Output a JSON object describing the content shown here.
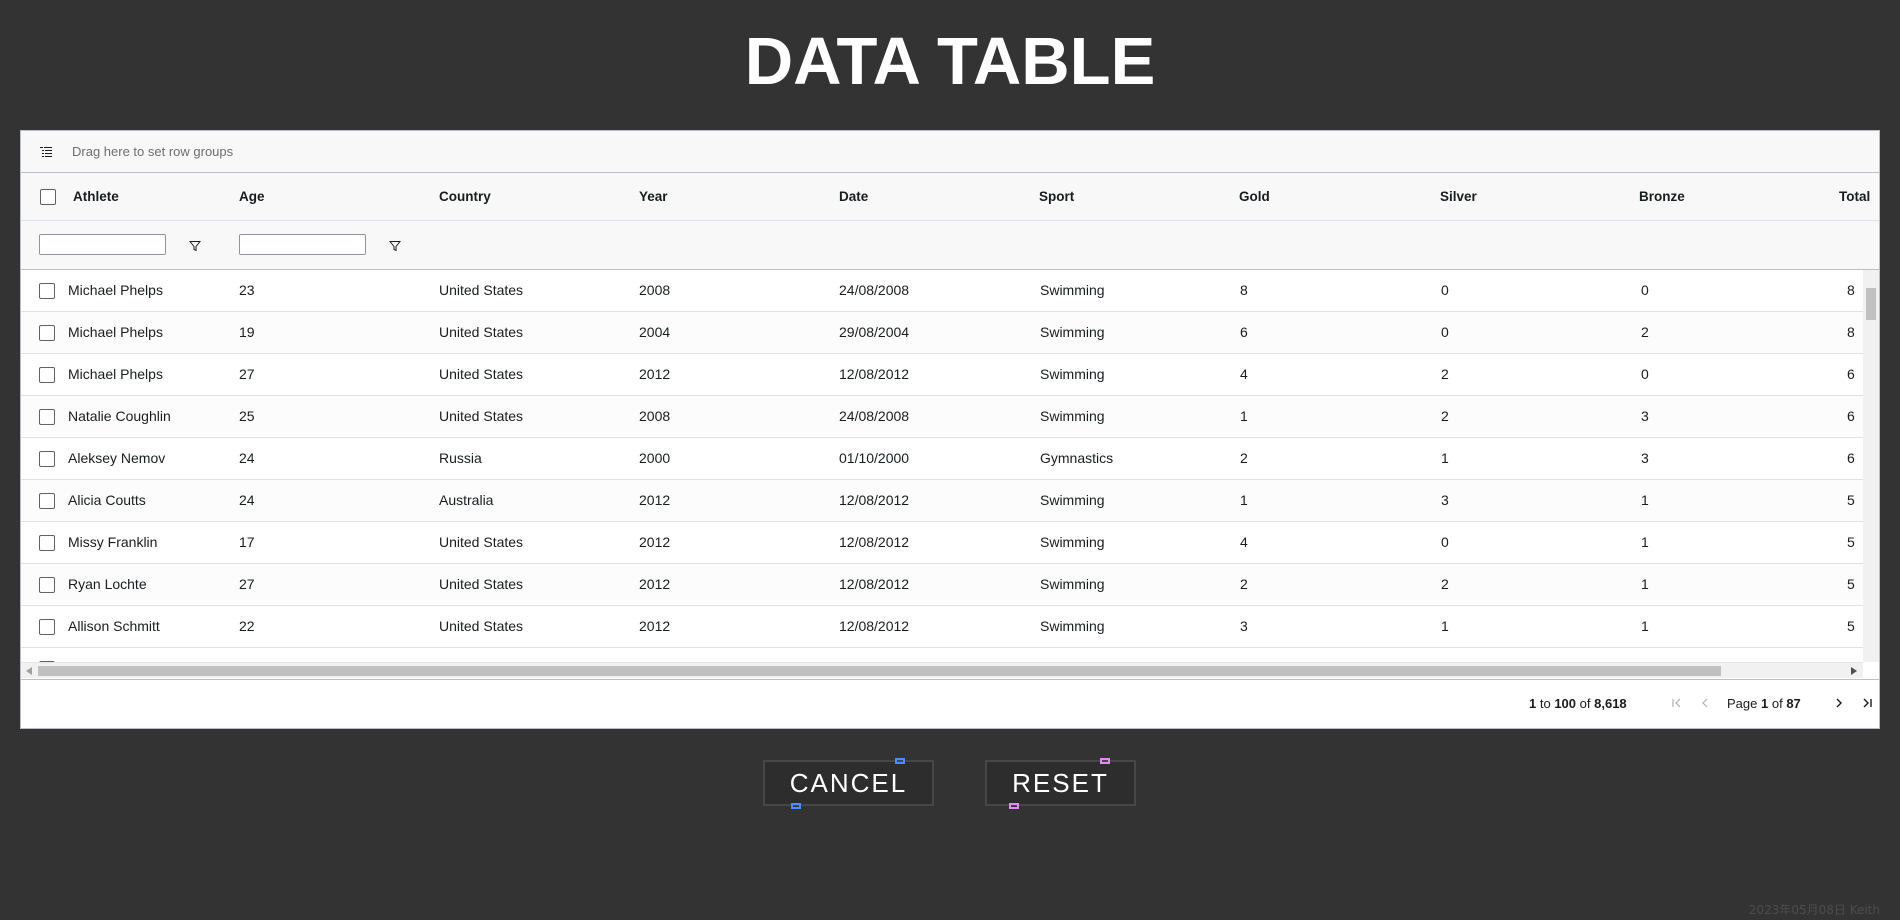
{
  "page": {
    "title": "DATA TABLE",
    "footer_credit": "2023年05月08日 Keith"
  },
  "grid": {
    "group_panel_text": "Drag here to set row groups",
    "columns": [
      "Athlete",
      "Age",
      "Country",
      "Year",
      "Date",
      "Sport",
      "Gold",
      "Silver",
      "Bronze",
      "Total"
    ],
    "rows": [
      [
        "Michael Phelps",
        "23",
        "United States",
        "2008",
        "24/08/2008",
        "Swimming",
        "8",
        "0",
        "0",
        "8"
      ],
      [
        "Michael Phelps",
        "19",
        "United States",
        "2004",
        "29/08/2004",
        "Swimming",
        "6",
        "0",
        "2",
        "8"
      ],
      [
        "Michael Phelps",
        "27",
        "United States",
        "2012",
        "12/08/2012",
        "Swimming",
        "4",
        "2",
        "0",
        "6"
      ],
      [
        "Natalie Coughlin",
        "25",
        "United States",
        "2008",
        "24/08/2008",
        "Swimming",
        "1",
        "2",
        "3",
        "6"
      ],
      [
        "Aleksey Nemov",
        "24",
        "Russia",
        "2000",
        "01/10/2000",
        "Gymnastics",
        "2",
        "1",
        "3",
        "6"
      ],
      [
        "Alicia Coutts",
        "24",
        "Australia",
        "2012",
        "12/08/2012",
        "Swimming",
        "1",
        "3",
        "1",
        "5"
      ],
      [
        "Missy Franklin",
        "17",
        "United States",
        "2012",
        "12/08/2012",
        "Swimming",
        "4",
        "0",
        "1",
        "5"
      ],
      [
        "Ryan Lochte",
        "27",
        "United States",
        "2012",
        "12/08/2012",
        "Swimming",
        "2",
        "2",
        "1",
        "5"
      ],
      [
        "Allison Schmitt",
        "22",
        "United States",
        "2012",
        "12/08/2012",
        "Swimming",
        "3",
        "1",
        "1",
        "5"
      ]
    ],
    "paging": {
      "range_start": "1",
      "to_word": "to",
      "range_end": "100",
      "of_word": "of",
      "total_rows": "8,618",
      "page_word": "Page",
      "current_page": "1",
      "of_word2": "of",
      "total_pages": "87"
    }
  },
  "buttons": {
    "cancel_label": "CANCEL",
    "reset_label": "RESET"
  },
  "colors": {
    "background": "#333333",
    "cancel_handle": "#4a8cff",
    "reset_handle": "#e08cf0"
  },
  "icons": [
    "row-group-icon",
    "filter-icon",
    "first-page-icon",
    "previous-page-icon",
    "next-page-icon",
    "last-page-icon"
  ]
}
